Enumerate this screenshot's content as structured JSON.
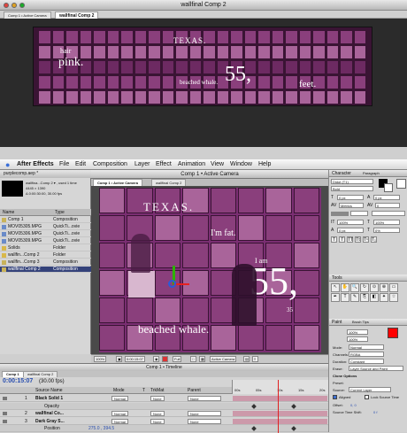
{
  "top_window": {
    "title": "wallfinal Comp 2",
    "tab": "wallfinal Comp 2",
    "tab_small": "Comp 1 • Active Camera"
  },
  "composition_text": {
    "pink_prefix": "hair",
    "pink": "pink.",
    "beached": "beached whale.",
    "im_fat": "I'm fat.",
    "fifty_five": "55,",
    "feet": "feet.",
    "texas": "TEXAS.",
    "thirty_five": "35",
    "i_am": "I am"
  },
  "menubar": {
    "app": "After Effects",
    "items": [
      "File",
      "Edit",
      "Composition",
      "Layer",
      "Effect",
      "Animation",
      "View",
      "Window",
      "Help"
    ]
  },
  "main_window": {
    "title": "Comp 1 • Active Camera"
  },
  "project": {
    "title": "purplecomp.aep *",
    "thumb_info_name": "wallfina...Comp 2 ▾ , used 1 time",
    "thumb_info_size": "4445 × 1390",
    "thumb_info_dur": "Δ 0:00:30:00, 30.00 fps",
    "col_name": "Name",
    "col_type": "Type",
    "items": [
      {
        "name": "Comp 1",
        "type": "Composition",
        "color": "#c9b35a"
      },
      {
        "name": "MOV05305.MPG",
        "type": "QuickTi...ovie",
        "color": "#6a8bc9"
      },
      {
        "name": "MOV05306.MPG",
        "type": "QuickTi...ovie",
        "color": "#6a8bc9"
      },
      {
        "name": "MOV05309.MPG",
        "type": "QuickTi...ovie",
        "color": "#6a8bc9"
      },
      {
        "name": "Solids",
        "type": "Folder",
        "color": "#d8b84b"
      },
      {
        "name": "wallfin...Comp 2",
        "type": "Folder",
        "color": "#d8b84b"
      },
      {
        "name": "wallfin...Comp 3",
        "type": "Composition",
        "color": "#c9b35a"
      },
      {
        "name": "wallfinal Comp 2",
        "type": "Composition",
        "color": "#c9b35a",
        "selected": true
      }
    ]
  },
  "viewer": {
    "tab1": "Comp 1 • Active Camera",
    "tab2": "wallfinal Comp 2",
    "zoom": "100%",
    "timecode": "0:00:15:07",
    "resolution": "Full",
    "camera": "Active Camera"
  },
  "character_panel": {
    "title": "Character",
    "tab2": "Paragraph",
    "font": "Didot (T1)",
    "style": "Bold",
    "size": "0 px",
    "leading": "0 px",
    "kerning": "Metrics",
    "tracking": "0",
    "scale_v": "100%",
    "scale_h": "100%",
    "baseline": "0 px",
    "tsume": "0%",
    "style_buttons": [
      "T",
      "T",
      "TT",
      "Tt",
      "T¹",
      "T₁"
    ]
  },
  "tools_panel": {
    "title": "Tools"
  },
  "paint_panel": {
    "title": "Paint",
    "tab2": "Brush Tips",
    "opacity": "100%",
    "flow": "100%",
    "mode_label": "Mode:",
    "mode": "Normal",
    "channels_label": "Channels:",
    "channels": "RGBA",
    "duration_label": "Duration:",
    "duration": "Constant",
    "erase_label": "Erase:",
    "erase": "Layer Source and Paint",
    "clone_options": "Clone Options",
    "preset_label": "Preset:",
    "source_label": "Source:",
    "source": "Current Layer",
    "aligned_label": "Aligned",
    "lock_source": "Lock Source Time",
    "offset_label": "Offset:",
    "offset": "0, 0",
    "source_time_label": "Source Time Shift:",
    "source_time": "0 f",
    "accent": "#ff0000"
  },
  "timeline": {
    "title": "Comp 1 • Timeline",
    "tab": "Comp 1",
    "tab2": "wallfinal Comp 2",
    "timecode": "0:00:15:07",
    "fps": "(30.00 fps)",
    "col_source": "Source Name",
    "col_mode": "Mode",
    "col_t": "T",
    "col_trkmat": "TrkMat",
    "col_parent": "Parent",
    "ruler": [
      "00s",
      "05s",
      "10s",
      "15s",
      "20s"
    ],
    "layers": [
      {
        "num": "1",
        "name": "Black Solid 1",
        "mode": "Normal",
        "parent": "None",
        "color": "#cc99aa"
      },
      {
        "num": "",
        "name": "Opacity",
        "mode": "",
        "parent": "",
        "color": ""
      },
      {
        "num": "2",
        "name": "wallfinal Co...",
        "mode": "Normal",
        "parent": "None",
        "color": "#cc99aa"
      },
      {
        "num": "3",
        "name": "Dark Gray S...",
        "mode": "Normal",
        "parent": "None",
        "color": "#cc99aa"
      },
      {
        "num": "",
        "name": "Position",
        "mode": "",
        "parent": "",
        "color": ""
      }
    ],
    "trkmat": "None",
    "position_value": "275.0 , 394.5"
  }
}
